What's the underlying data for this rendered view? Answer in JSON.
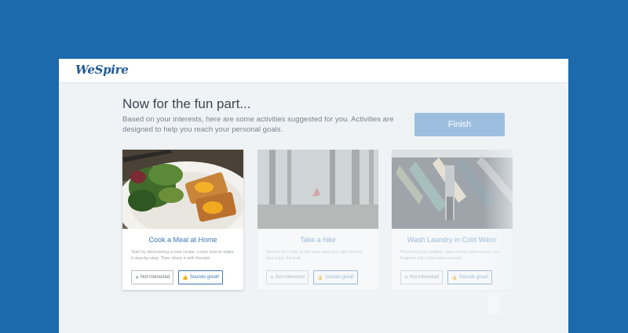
{
  "app": {
    "logo": "WeSpire"
  },
  "intro": {
    "heading": "Now for the fun part...",
    "subtext": "Based on your interests, here are some activities suggested for you. Activities are designed to help you reach your personal goals."
  },
  "finish_label": "Finish",
  "cards": [
    {
      "title": "Cook a Meal at Home",
      "desc": "Start by discovering a new recipe. Learn how to make it step-by-step. Then share it with friends!",
      "not_label": "Not interested",
      "great_label": "Sounds great!"
    },
    {
      "title": "Take a hike",
      "desc": "Search for a hike in the area near you, get moving and enjoy the trail.",
      "not_label": "Not interested",
      "great_label": "Sounds great!"
    },
    {
      "title": "Wash Laundry in Cold Water",
      "desc": "Preserve your clothes, save money and reduce your footprint with cold water washes.",
      "not_label": "Not interested",
      "great_label": "Sounds great!"
    }
  ],
  "icons": {
    "close": "✕",
    "thumb": "👍"
  },
  "colors": {
    "page_bg": "#1c6aab",
    "accent": "#3a77b4",
    "finish": "#9dbfdf"
  }
}
